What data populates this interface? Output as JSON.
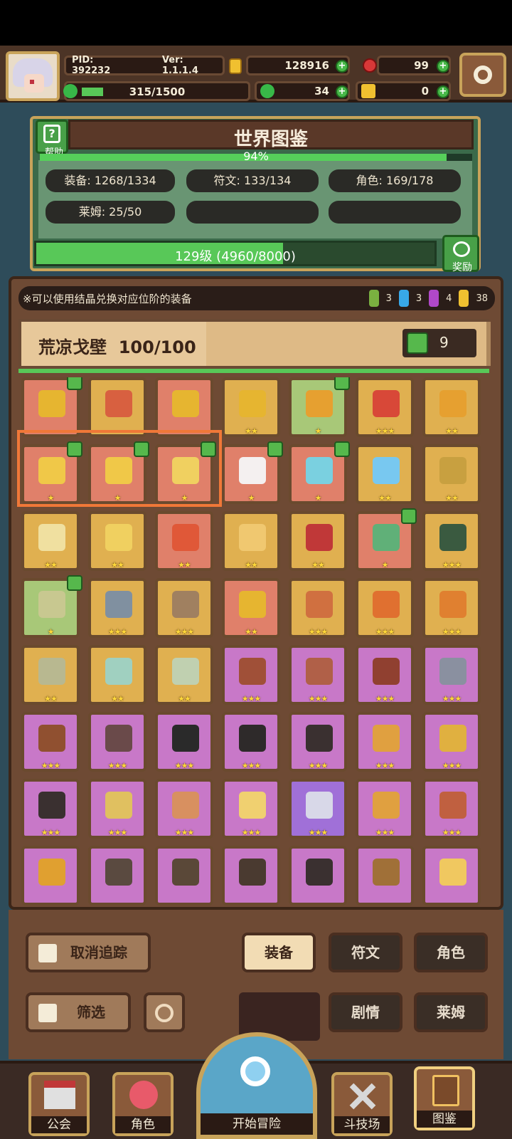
{
  "header": {
    "pid": "PID: 392232",
    "version": "Ver: 1.1.1.4",
    "stamina": "315/1500",
    "stamina_fraction": 0.21,
    "gold": "128916",
    "ruby": "99",
    "clover": "34",
    "ticket": "0"
  },
  "book": {
    "title": "世界图鉴",
    "help_label": "帮助",
    "percent": "94%",
    "percent_value": 0.94,
    "stats": [
      "装备: 1268/1334",
      "符文: 133/134",
      "角色: 169/178",
      "莱姆: 25/50"
    ],
    "level_text": "129级 (4960/8000)",
    "level_fraction": 0.62,
    "reward_label": "奖励"
  },
  "list": {
    "notice": "※可以使用结晶兑换对应位阶的装备",
    "crystals": [
      {
        "color": "#7ab040",
        "count": "3"
      },
      {
        "color": "#38a8e8",
        "count": "3"
      },
      {
        "color": "#b048c8",
        "count": "4"
      },
      {
        "color": "#f0c030",
        "count": "38"
      }
    ],
    "zone_name": "荒凉戈壁",
    "zone_progress": "100/100",
    "tracked_count": "9"
  },
  "items": [
    {
      "bg": "#e0806a",
      "icon": "#e6b530",
      "stars": "",
      "tag": true
    },
    {
      "bg": "#e0b050",
      "icon": "#d86040",
      "stars": "",
      "tag": false
    },
    {
      "bg": "#e0806a",
      "icon": "#e6b530",
      "stars": "",
      "tag": false
    },
    {
      "bg": "#e0b050",
      "icon": "#e6b530",
      "stars": "★★",
      "tag": false
    },
    {
      "bg": "#a8c878",
      "icon": "#e6a030",
      "stars": "★",
      "tag": true
    },
    {
      "bg": "#e0b050",
      "icon": "#d84838",
      "stars": "★★★",
      "tag": false
    },
    {
      "bg": "#e0b050",
      "icon": "#e6a030",
      "stars": "★★",
      "tag": false
    },
    {
      "bg": "#e0806a",
      "icon": "#f0c848",
      "stars": "★",
      "tag": true
    },
    {
      "bg": "#e0806a",
      "icon": "#f0c848",
      "stars": "★",
      "tag": true
    },
    {
      "bg": "#e0806a",
      "icon": "#f0d060",
      "stars": "★",
      "tag": true
    },
    {
      "bg": "#e0806a",
      "icon": "#f4f0f0",
      "stars": "★",
      "tag": true
    },
    {
      "bg": "#e0806a",
      "icon": "#7ad0e0",
      "stars": "★",
      "tag": true
    },
    {
      "bg": "#e0b050",
      "icon": "#78c8f0",
      "stars": "★★",
      "tag": false
    },
    {
      "bg": "#e0b050",
      "icon": "#c8a040",
      "stars": "★★",
      "tag": false
    },
    {
      "bg": "#e0b050",
      "icon": "#f0e0a0",
      "stars": "★★",
      "tag": false
    },
    {
      "bg": "#e0b050",
      "icon": "#f0d060",
      "stars": "★★",
      "tag": false
    },
    {
      "bg": "#e0806a",
      "icon": "#e05838",
      "stars": "★★",
      "tag": false
    },
    {
      "bg": "#e0b050",
      "icon": "#f0c870",
      "stars": "★★",
      "tag": false
    },
    {
      "bg": "#e0b050",
      "icon": "#c03838",
      "stars": "★★",
      "tag": false
    },
    {
      "bg": "#e0806a",
      "icon": "#60b078",
      "stars": "★",
      "tag": true
    },
    {
      "bg": "#e0b050",
      "icon": "#3a5a40",
      "stars": "★★★",
      "tag": false
    },
    {
      "bg": "#a8c878",
      "icon": "#c8c890",
      "stars": "★",
      "tag": true
    },
    {
      "bg": "#e0b050",
      "icon": "#8090a0",
      "stars": "★★★",
      "tag": false
    },
    {
      "bg": "#e0b050",
      "icon": "#a08060",
      "stars": "★★★",
      "tag": false
    },
    {
      "bg": "#e0806a",
      "icon": "#e6b530",
      "stars": "★★",
      "tag": false
    },
    {
      "bg": "#e0b050",
      "icon": "#d07040",
      "stars": "★★★",
      "tag": false
    },
    {
      "bg": "#e0b050",
      "icon": "#e07030",
      "stars": "★★★",
      "tag": false
    },
    {
      "bg": "#e0b050",
      "icon": "#e08030",
      "stars": "★★★",
      "tag": false
    },
    {
      "bg": "#e0b050",
      "icon": "#b8b890",
      "stars": "★★",
      "tag": false
    },
    {
      "bg": "#e0b050",
      "icon": "#a0d0c0",
      "stars": "★★",
      "tag": false
    },
    {
      "bg": "#e0b050",
      "icon": "#c0d0b0",
      "stars": "★★",
      "tag": false
    },
    {
      "bg": "#c878c8",
      "icon": "#a05038",
      "stars": "★★★",
      "tag": false
    },
    {
      "bg": "#c878c8",
      "icon": "#b06048",
      "stars": "★★★",
      "tag": false
    },
    {
      "bg": "#c878c8",
      "icon": "#904030",
      "stars": "★★★",
      "tag": false
    },
    {
      "bg": "#c878c8",
      "icon": "#8a90a0",
      "stars": "★★★",
      "tag": false
    },
    {
      "bg": "#c878c8",
      "icon": "#905030",
      "stars": "★★★",
      "tag": false
    },
    {
      "bg": "#c878c8",
      "icon": "#6a4a4a",
      "stars": "★★★",
      "tag": false
    },
    {
      "bg": "#c878c8",
      "icon": "#2a2a2a",
      "stars": "★★★",
      "tag": false
    },
    {
      "bg": "#c878c8",
      "icon": "#2e2a2a",
      "stars": "★★★",
      "tag": false
    },
    {
      "bg": "#c878c8",
      "icon": "#3a3030",
      "stars": "★★★",
      "tag": false
    },
    {
      "bg": "#c878c8",
      "icon": "#e0a040",
      "stars": "★★★",
      "tag": false
    },
    {
      "bg": "#c878c8",
      "icon": "#e0b040",
      "stars": "★★★",
      "tag": false
    },
    {
      "bg": "#c878c8",
      "icon": "#3a3030",
      "stars": "★★★",
      "tag": false
    },
    {
      "bg": "#c878c8",
      "icon": "#e0c060",
      "stars": "★★★",
      "tag": false
    },
    {
      "bg": "#c878c8",
      "icon": "#d89060",
      "stars": "★★★",
      "tag": false
    },
    {
      "bg": "#c878c8",
      "icon": "#f0d070",
      "stars": "★★★",
      "tag": false
    },
    {
      "bg": "#a070d8",
      "icon": "#d8d8e8",
      "stars": "★★★",
      "tag": false
    },
    {
      "bg": "#c878c8",
      "icon": "#e0a040",
      "stars": "★★★",
      "tag": false
    },
    {
      "bg": "#c878c8",
      "icon": "#c06040",
      "stars": "★★★",
      "tag": false
    },
    {
      "bg": "#c878c8",
      "icon": "#e0a030",
      "stars": "",
      "tag": false
    },
    {
      "bg": "#c878c8",
      "icon": "#5a4a40",
      "stars": "",
      "tag": false
    },
    {
      "bg": "#c878c8",
      "icon": "#5a4838",
      "stars": "",
      "tag": false
    },
    {
      "bg": "#c878c8",
      "icon": "#4a3a30",
      "stars": "",
      "tag": false
    },
    {
      "bg": "#c878c8",
      "icon": "#3a3030",
      "stars": "",
      "tag": false
    },
    {
      "bg": "#c878c8",
      "icon": "#a07038",
      "stars": "",
      "tag": false
    },
    {
      "bg": "#c878c8",
      "icon": "#f0c860",
      "stars": "",
      "tag": false
    }
  ],
  "controls": {
    "untrack": "取消追踪",
    "filter": "筛选",
    "tab_equipment": "装备",
    "tab_rune": "符文",
    "tab_character": "角色",
    "tab_story": "剧情",
    "tab_slime": "莱姆"
  },
  "nav": {
    "guild": "公会",
    "character": "角色",
    "adventure": "开始冒险",
    "arena": "斗技场",
    "codex": "图鉴"
  }
}
